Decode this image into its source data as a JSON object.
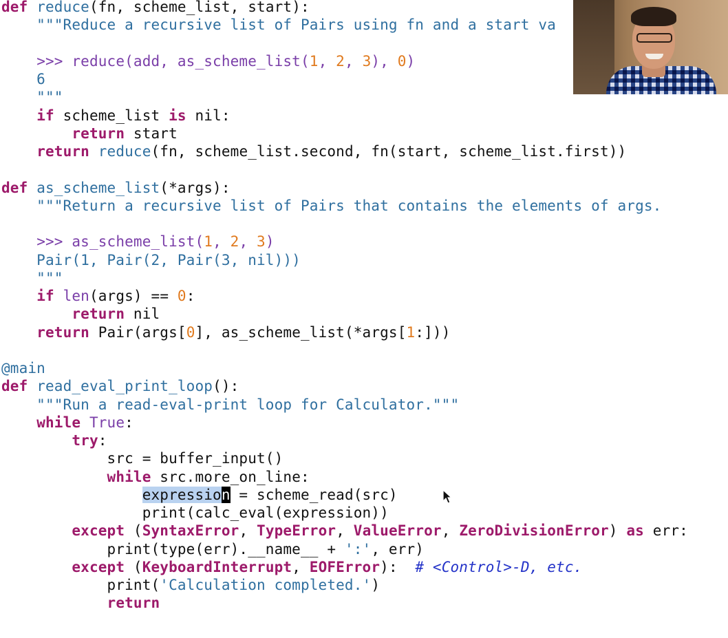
{
  "code": {
    "l01": {
      "t1": "def",
      "t2": " ",
      "t3": "reduce",
      "t4": "(fn, scheme_list, start):"
    },
    "l02": {
      "t1": "    \"\"\"Reduce a recursive list of Pairs using fn and a start va"
    },
    "l03": {},
    "l04": {
      "t1": "    ",
      "t2": ">>> reduce(add, as_scheme_list(",
      "t3": "1",
      ",t4": "",
      "t4": ", ",
      "t5": "2",
      "t6": ", ",
      "t7": "3",
      "t8": "), ",
      "t9": "0",
      "t10": ")"
    },
    "l05": {
      "t1": "    6"
    },
    "l06": {
      "t1": "    \"\"\""
    },
    "l07": {
      "t1": "    ",
      "t2": "if",
      "t3": " scheme_list ",
      "t4": "is",
      "t5": " nil:"
    },
    "l08": {
      "t1": "        ",
      "t2": "return",
      "t3": " start"
    },
    "l09": {
      "t1": "    ",
      "t2": "return",
      "t3": " ",
      "t4": "reduce",
      "t5": "(fn, scheme_list.second, fn(start, scheme_list.first))"
    },
    "l10": {},
    "l11": {
      "t1": "def",
      "t2": " ",
      "t3": "as_scheme_list",
      "t4": "(*args):"
    },
    "l12": {
      "t1": "    \"\"\"Return a recursive list of Pairs that contains the elements of args."
    },
    "l13": {},
    "l14": {
      "t1": "    ",
      "t2": ">>> as_scheme_list(",
      "t3": "1",
      "t4": ", ",
      "t5": "2",
      "t6": ", ",
      "t7": "3",
      "t8": ")"
    },
    "l15": {
      "t1": "    Pair(1, Pair(2, Pair(3, nil)))"
    },
    "l16": {
      "t1": "    \"\"\""
    },
    "l17": {
      "t1": "    ",
      "t2": "if",
      "t3": " ",
      "t4": "len",
      "t5": "(args) == ",
      "t6": "0",
      "t7": ":"
    },
    "l18": {
      "t1": "        ",
      "t2": "return",
      "t3": " nil"
    },
    "l19": {
      "t1": "    ",
      "t2": "return",
      "t3": " Pair(args[",
      "t4": "0",
      "t5": "], as_scheme_list(*args[",
      "t6": "1",
      "t7": ":]))"
    },
    "l20": {},
    "l21": {
      "t1": "@main"
    },
    "l22": {
      "t1": "def",
      "t2": " ",
      "t3": "read_eval_print_loop",
      "t4": "():"
    },
    "l23": {
      "t1": "    \"\"\"Run a read-eval-print loop for Calculator.\"\"\""
    },
    "l24": {
      "t1": "    ",
      "t2": "while",
      "t3": " ",
      "t4": "True",
      ":t5": "",
      "t5": ":"
    },
    "l25": {
      "t1": "        ",
      "t2": "try",
      ":t3": "",
      "t3": ":"
    },
    "l26": {
      "t1": "            src = buffer_input()"
    },
    "l27": {
      "t1": "            ",
      "t2": "while",
      "t3": " src.more_on_line:"
    },
    "l28": {
      "t1": "                ",
      "t2": "expressio",
      "t3": "n",
      "t4": " = scheme_read(src)"
    },
    "l29": {
      "t1": "                print(calc_eval(expression))"
    },
    "l30": {
      "t1": "        ",
      "t2": "except",
      "t3": " (",
      "t4": "SyntaxError",
      "t5": ", ",
      "t6": "TypeError",
      "t7": ", ",
      "t8": "ValueError",
      "t9": ", ",
      "t10": "ZeroDivisionError",
      "t11": ") ",
      "t12": "as",
      "t13": " err:"
    },
    "l31": {
      "t1": "            print(type(err).__name__ + ",
      "t2": "':'",
      "t3": ", err)"
    },
    "l32": {
      "t1": "        ",
      "t2": "except",
      "t3": " (",
      "t4": "KeyboardInterrupt",
      "t5": ", ",
      "t6": "EOFError",
      "t7": "):  ",
      "t8": "# <Control>-D, etc."
    },
    "l33": {
      "t1": "            print(",
      "t2": "'Calculation completed.'",
      "t3": ")"
    },
    "l34": {
      "t1": "            ",
      "t2": "return"
    }
  },
  "colors": {
    "keyword": "#9d1a6a",
    "function": "#2f6f9f",
    "builtin": "#7a3ea8",
    "number": "#e07a1e",
    "comment": "#2433c8",
    "selection": "#b9d2f0"
  },
  "icons": {
    "cursor": "arrow-pointer-icon"
  }
}
